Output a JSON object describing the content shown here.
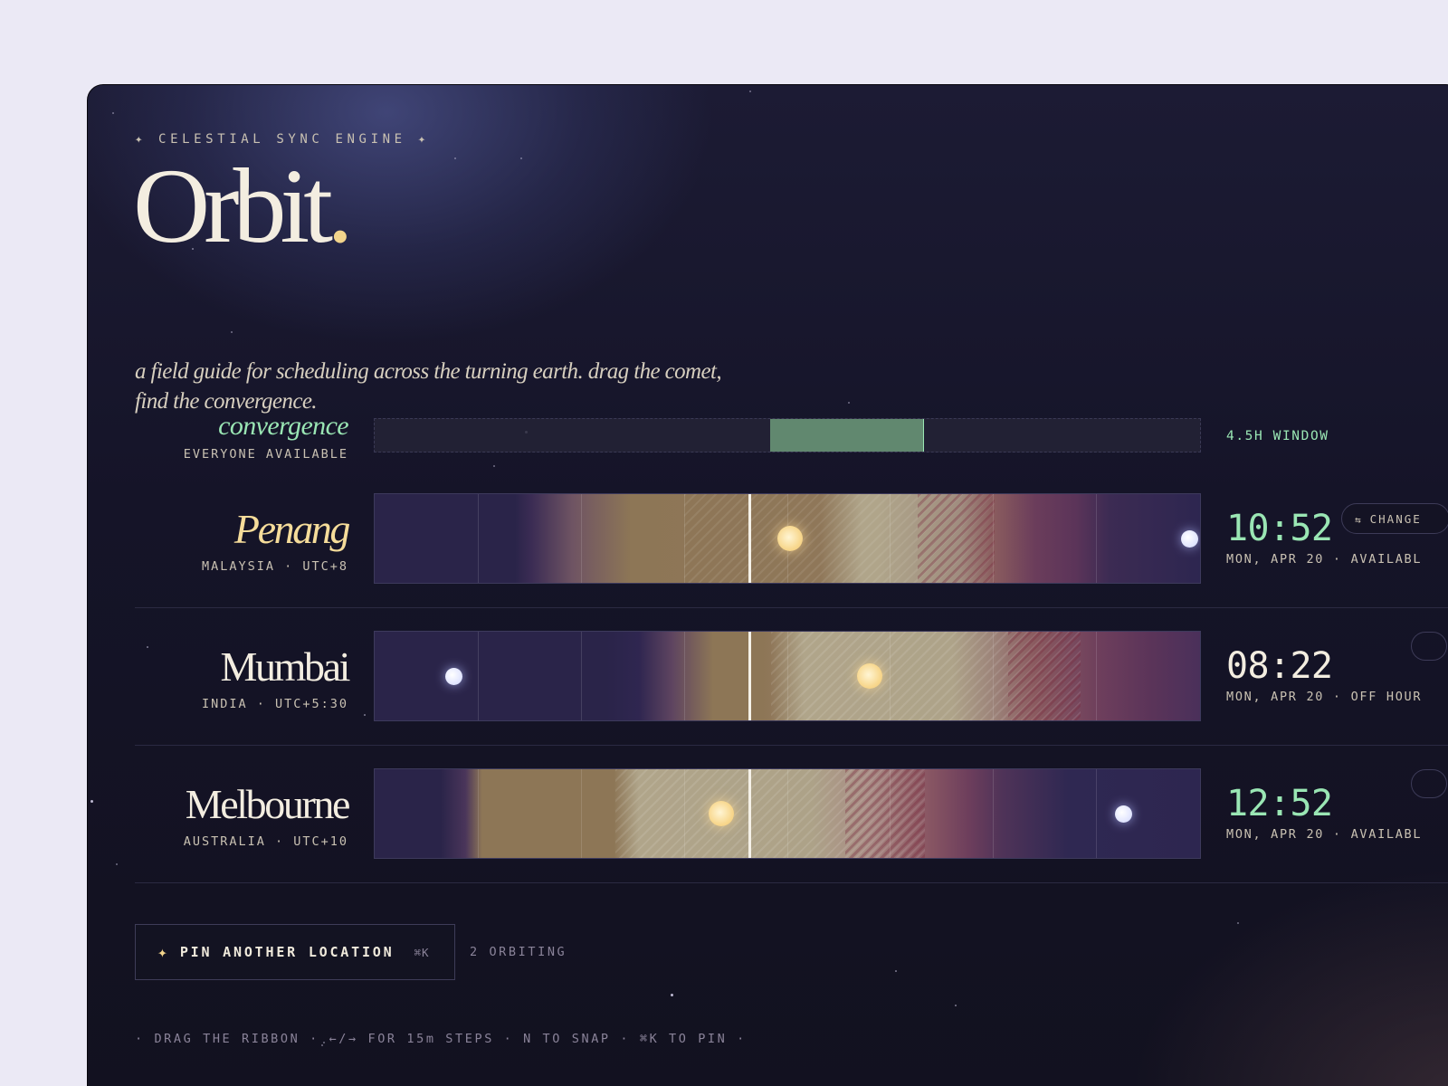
{
  "header": {
    "eyebrow": "✦ CELESTIAL SYNC ENGINE ✦",
    "brand": "Orbit",
    "brand_dot": ".",
    "tagline": "a field guide for scheduling across the turning earth. drag the comet, find the convergence."
  },
  "convergence": {
    "title": "convergence",
    "subtitle": "EVERYONE AVAILABLE",
    "window_label": "4.5H WINDOW",
    "window_start_hour": 11.5,
    "window_end_hour": 16,
    "window_color": "#83bd8f"
  },
  "timeline": {
    "hour_span": 24,
    "current_hour": 10.87
  },
  "locations": [
    {
      "name": "Penang",
      "subtitle": "MALAYSIA · UTC+8",
      "time": "10:52",
      "status_line": "MON, APR 20 · AVAILABL",
      "status": "available",
      "active": true,
      "sun_hour": 12.1,
      "moon_hour": 23.7,
      "action_label": "CHANGE",
      "action_icon": "swap-icon"
    },
    {
      "name": "Mumbai",
      "subtitle": "INDIA · UTC+5:30",
      "time": "08:22",
      "status_line": "MON, APR 20 · OFF HOUR",
      "status": "off-hours",
      "active": false,
      "sun_hour": 14.4,
      "moon_hour": 2.3
    },
    {
      "name": "Melbourne",
      "subtitle": "AUSTRALIA · UTC+10",
      "time": "12:52",
      "status_line": "MON, APR 20 · AVAILABL",
      "status": "available",
      "active": false,
      "sun_hour": 10.1,
      "moon_hour": 21.8
    }
  ],
  "pin": {
    "icon": "sparkle-icon",
    "label": "PIN ANOTHER LOCATION",
    "shortcut": "⌘K",
    "count_text": "2 ORBITING"
  },
  "hints": "· DRAG THE RIBBON · ←/→ FOR 15m STEPS · N TO SNAP · ⌘K TO PIN ·",
  "colors": {
    "available": "#9ae6b4",
    "accent": "#f2d48c",
    "text": "#f3ede0"
  }
}
